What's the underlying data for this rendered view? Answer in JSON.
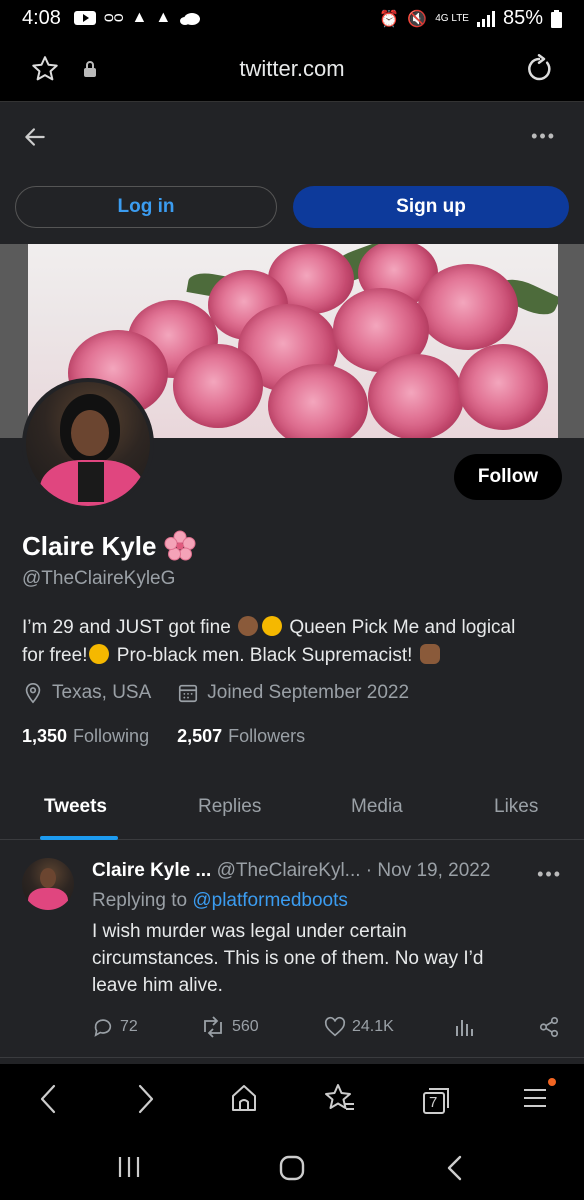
{
  "status_bar": {
    "time": "4:08",
    "battery": "85%",
    "network": "4G LTE"
  },
  "browser": {
    "url": "twitter.com"
  },
  "auth": {
    "login_label": "Log in",
    "signup_label": "Sign up"
  },
  "profile": {
    "follow_label": "Follow",
    "name": "Claire Kyle",
    "handle": "@TheClaireKyleG",
    "bio_line1": "I’m 29 and JUST got fine",
    "bio_line1b": "Queen Pick Me and logical",
    "bio_line2a": "for free!",
    "bio_line2b": "Pro-black men. Black Supremacist!",
    "location": "Texas, USA",
    "joined": "Joined September 2022",
    "following_count": "1,350",
    "following_label": "Following",
    "followers_count": "2,507",
    "followers_label": "Followers"
  },
  "tabs": [
    {
      "label": "Tweets",
      "active": true
    },
    {
      "label": "Replies",
      "active": false
    },
    {
      "label": "Media",
      "active": false
    },
    {
      "label": "Likes",
      "active": false
    }
  ],
  "tweet": {
    "author": "Claire Kyle ...",
    "handle": "@TheClaireKyl...",
    "date": "· Nov 19, 2022",
    "replying_prefix": "Replying to",
    "replying_to": "@platformedboots",
    "text": "I wish murder was legal under certain circumstances. This is one of them. No way I’d leave him alive.",
    "replies": "72",
    "retweets": "560",
    "likes": "24.1K"
  },
  "browser_nav": {
    "tab_count": "7"
  },
  "colors": {
    "link_blue": "#3b9cf0",
    "signup_bg": "#0d3a9b",
    "page_bg": "#222326"
  }
}
